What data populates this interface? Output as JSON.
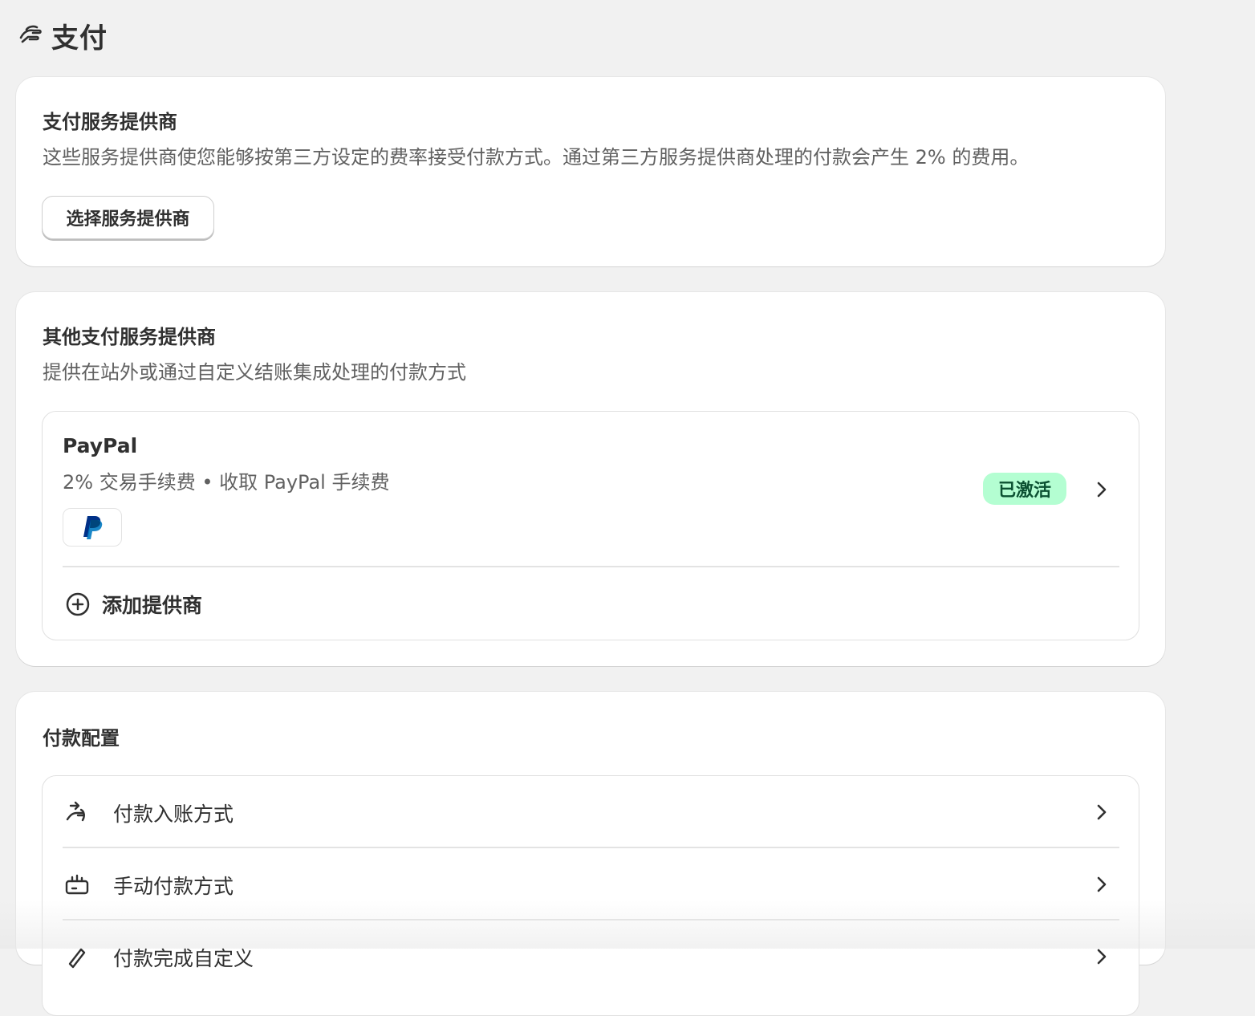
{
  "page": {
    "title": "支付",
    "title_icon": "payment-hand-icon"
  },
  "payment_providers": {
    "title": "支付服务提供商",
    "description": "这些服务提供商使您能够按第三方设定的费率接受付款方式。通过第三方服务提供商处理的付款会产生 2% 的费用。",
    "button_label": "选择服务提供商"
  },
  "other_providers": {
    "title": "其他支付服务提供商",
    "description": "提供在站外或通过自定义结账集成处理的付款方式",
    "provider": {
      "name": "PayPal",
      "fee": "2% 交易手续费 • 收取 PayPal 手续费",
      "logo": "paypal-logo",
      "status": "已激活",
      "status_color": "#b4fed2"
    },
    "add_provider_label": "添加提供商"
  },
  "payment_config": {
    "title": "付款配置",
    "items": [
      {
        "label": "付款入账方式",
        "icon": "payout-icon"
      },
      {
        "label": "手动付款方式",
        "icon": "manual-payment-icon"
      },
      {
        "label": "付款完成自定义",
        "icon": "customization-icon"
      }
    ]
  }
}
